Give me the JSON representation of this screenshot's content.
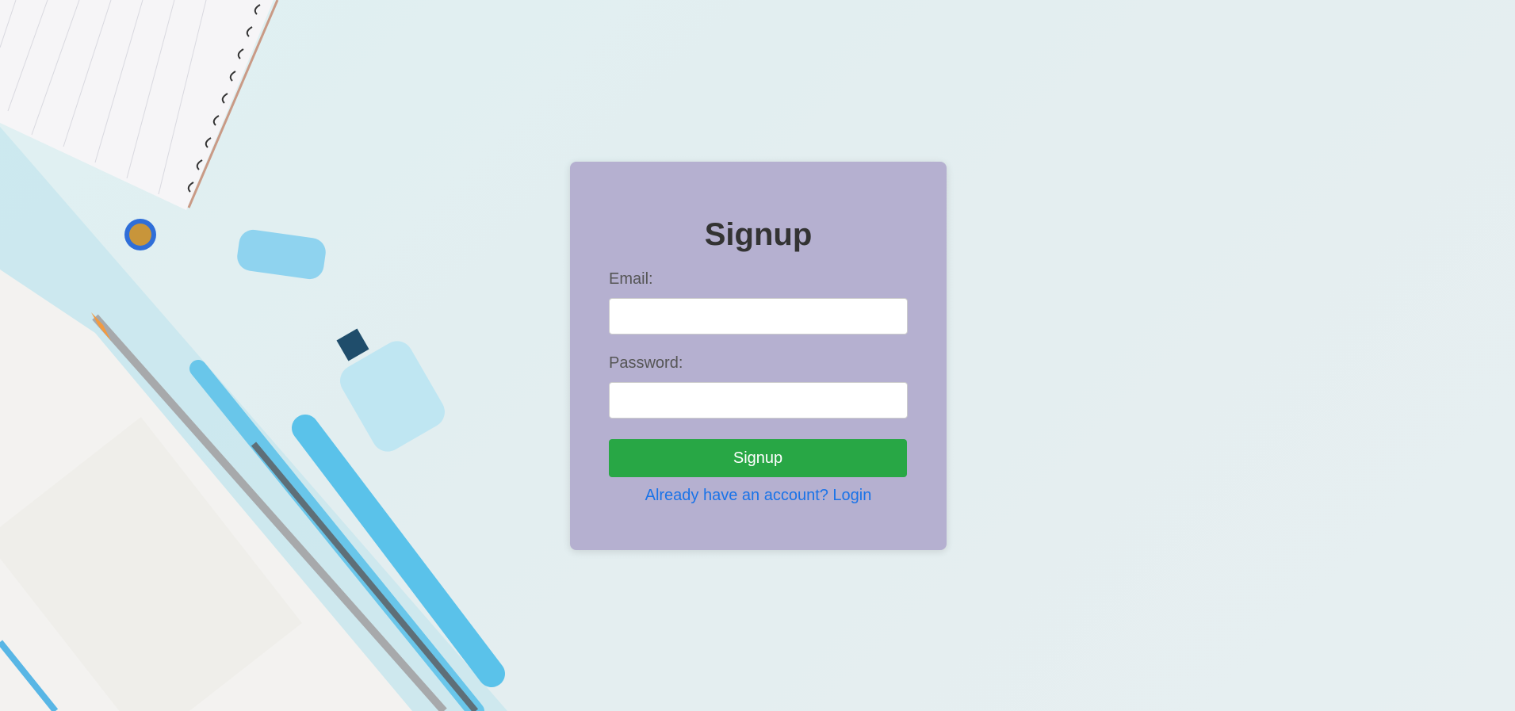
{
  "form": {
    "title": "Signup",
    "email_label": "Email:",
    "email_value": "",
    "email_placeholder": "",
    "password_label": "Password:",
    "password_value": "",
    "password_placeholder": "",
    "submit_label": "Signup",
    "login_link": "Already have an account? Login"
  },
  "colors": {
    "card_background": "#b5b0d0",
    "button_background": "#28a745",
    "link_color": "#1a73e8",
    "title_color": "#333333"
  },
  "background": {
    "description_icons": [
      "notebook-icon",
      "pencil-icon",
      "pen-icon",
      "pen-cap-icon",
      "highlighter-icon",
      "pin-icon"
    ]
  }
}
